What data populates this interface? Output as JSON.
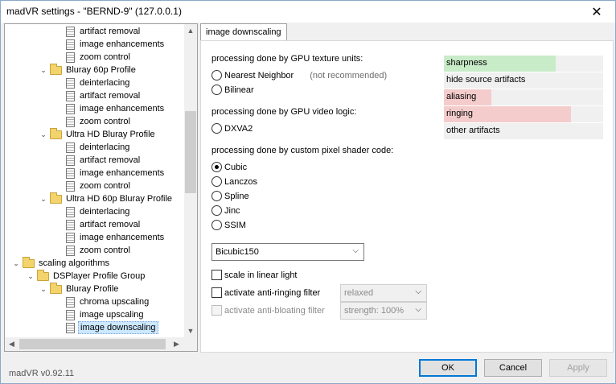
{
  "window": {
    "title": "madVR settings - \"BERND-9\" (127.0.0.1)"
  },
  "tree": {
    "rows": [
      {
        "label": "artifact removal",
        "icon": "page",
        "level": 4
      },
      {
        "label": "image enhancements",
        "icon": "page",
        "level": 4
      },
      {
        "label": "zoom control",
        "icon": "page",
        "level": 4
      },
      {
        "label": "Bluray 60p Profile",
        "icon": "folder",
        "level": 3,
        "expander": "-"
      },
      {
        "label": "deinterlacing",
        "icon": "page",
        "level": 4
      },
      {
        "label": "artifact removal",
        "icon": "page",
        "level": 4
      },
      {
        "label": "image enhancements",
        "icon": "page",
        "level": 4
      },
      {
        "label": "zoom control",
        "icon": "page",
        "level": 4
      },
      {
        "label": "Ultra HD Bluray Profile",
        "icon": "folder",
        "level": 3,
        "expander": "-"
      },
      {
        "label": "deinterlacing",
        "icon": "page",
        "level": 4
      },
      {
        "label": "artifact removal",
        "icon": "page",
        "level": 4
      },
      {
        "label": "image enhancements",
        "icon": "page",
        "level": 4
      },
      {
        "label": "zoom control",
        "icon": "page",
        "level": 4
      },
      {
        "label": "Ultra HD 60p Bluray Profile",
        "icon": "folder",
        "level": 3,
        "expander": "-"
      },
      {
        "label": "deinterlacing",
        "icon": "page",
        "level": 4
      },
      {
        "label": "artifact removal",
        "icon": "page",
        "level": 4
      },
      {
        "label": "image enhancements",
        "icon": "page",
        "level": 4
      },
      {
        "label": "zoom control",
        "icon": "page",
        "level": 4
      },
      {
        "label": "scaling algorithms",
        "icon": "folder",
        "level": 1,
        "expander": "-"
      },
      {
        "label": "DSPlayer Profile Group",
        "icon": "folder",
        "level": 2,
        "expander": "-"
      },
      {
        "label": "Bluray Profile",
        "icon": "folder",
        "level": 3,
        "expander": "-"
      },
      {
        "label": "chroma upscaling",
        "icon": "page",
        "level": 4
      },
      {
        "label": "image upscaling",
        "icon": "page",
        "level": 4
      },
      {
        "label": "image downscaling",
        "icon": "page",
        "level": 4,
        "selected": true
      }
    ]
  },
  "tab": {
    "label": "image downscaling"
  },
  "gpu_texture": {
    "heading": "processing done by GPU texture units:",
    "options": [
      {
        "label": "Nearest Neighbor",
        "note": "(not recommended)",
        "selected": false
      },
      {
        "label": "Bilinear",
        "note": "",
        "selected": false
      }
    ]
  },
  "gpu_video": {
    "heading": "processing done by GPU video logic:",
    "options": [
      {
        "label": "DXVA2",
        "selected": false
      }
    ]
  },
  "pixel_shader": {
    "heading": "processing done by custom pixel shader code:",
    "options": [
      {
        "label": "Cubic",
        "selected": true
      },
      {
        "label": "Lanczos",
        "selected": false
      },
      {
        "label": "Spline",
        "selected": false
      },
      {
        "label": "Jinc",
        "selected": false
      },
      {
        "label": "SSIM",
        "selected": false
      }
    ]
  },
  "algorithm_select": {
    "value": "Bicubic150"
  },
  "options": {
    "linear_light": {
      "label": "scale in linear light",
      "checked": false,
      "enabled": true
    },
    "anti_ringing": {
      "label": "activate anti-ringing filter",
      "checked": false,
      "enabled": true,
      "select_value": "relaxed"
    },
    "anti_bloating": {
      "label": "activate anti-bloating filter",
      "checked": false,
      "enabled": false,
      "select_value": "strength: 100%"
    }
  },
  "metrics": [
    {
      "label": "sharpness",
      "level": 0.7,
      "color": "#c8ebc8"
    },
    {
      "label": "hide source artifacts",
      "level": 0.0,
      "color": "#f0f0f0"
    },
    {
      "label": "aliasing",
      "level": 0.3,
      "color": "#f5cccc"
    },
    {
      "label": "ringing",
      "level": 0.8,
      "color": "#f5cccc"
    },
    {
      "label": "other artifacts",
      "level": 0.0,
      "color": "#f0f0f0"
    }
  ],
  "footer": {
    "version": "madVR v0.92.11",
    "ok": "OK",
    "cancel": "Cancel",
    "apply": "Apply"
  }
}
